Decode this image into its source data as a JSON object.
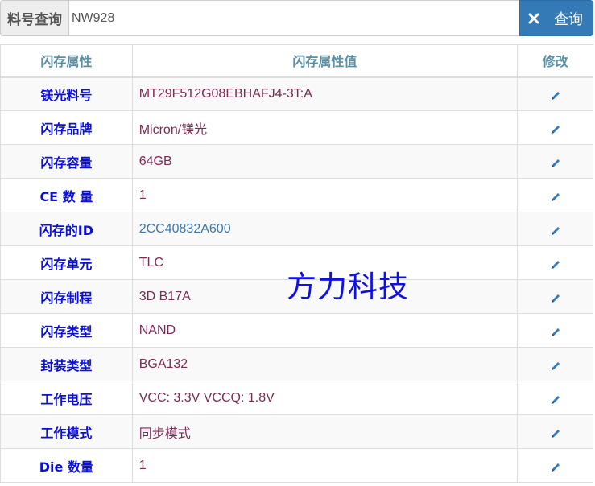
{
  "search": {
    "label": "料号查询",
    "value": "NW928",
    "button_label": "查询",
    "button_icon": "close-icon"
  },
  "table": {
    "headers": [
      "闪存属性",
      "闪存属性值",
      "修改"
    ],
    "rows": [
      {
        "name": "镁光料号",
        "value": "MT29F512G08EBHAFJ4-3T:A"
      },
      {
        "name": "闪存品牌",
        "value": "Micron/镁光"
      },
      {
        "name": "闪存容量",
        "value": "64GB"
      },
      {
        "name": "CE 数 量",
        "value": "1"
      },
      {
        "name": "闪存的ID",
        "value": "2CC40832A600"
      },
      {
        "name": "闪存单元",
        "value": "TLC"
      },
      {
        "name": "闪存制程",
        "value": "3D B17A"
      },
      {
        "name": "闪存类型",
        "value": "NAND"
      },
      {
        "name": "封装类型",
        "value": "BGA132"
      },
      {
        "name": "工作电压",
        "value": "VCC: 3.3V VCCQ: 1.8V"
      },
      {
        "name": "工作模式",
        "value": "同步模式"
      },
      {
        "name": "Die 数量",
        "value": "1"
      }
    ],
    "edit_icon": "pencil-icon"
  },
  "watermark": "方力科技",
  "colors": {
    "accent": "#337ab7",
    "header_text": "#5b8fa8",
    "name_text": "#0a10d6",
    "value_text": "#7a2a55",
    "link_text": "#3a78b0"
  }
}
